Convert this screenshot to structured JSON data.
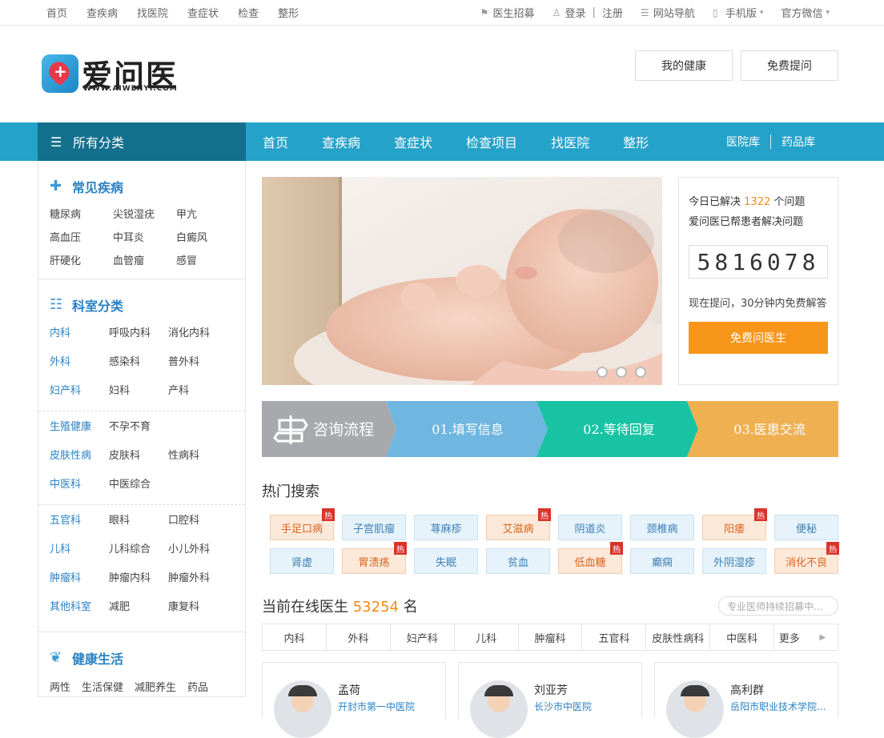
{
  "topbar": {
    "links": [
      "首页",
      "查疾病",
      "找医院",
      "查症状",
      "检查",
      "整形"
    ],
    "recruit": "医生招募",
    "login": "登录",
    "divider": "|",
    "register": "注册",
    "site_nav": "网站导航",
    "mobile": "手机版",
    "wechat": "官方微信"
  },
  "logo": {
    "brand": "爱问医",
    "url": "WWW.AIWENYI.COM"
  },
  "header": {
    "my_health": "我的健康",
    "free_ask": "免费提问"
  },
  "nav": {
    "all_categories": "所有分类",
    "items": [
      "首页",
      "查疾病",
      "查症状",
      "检查项目",
      "找医院",
      "整形"
    ],
    "hospital_lib": "医院库",
    "drug_lib": "药品库"
  },
  "sidebar": {
    "common_title": "常见疾病",
    "common": [
      "糖尿病",
      "尖锐湿疣",
      "甲亢",
      "高血压",
      "中耳炎",
      "白癜风",
      "肝硬化",
      "血管瘤",
      "感冒"
    ],
    "dept_title": "科室分类",
    "dept_groups": [
      [
        [
          "内科",
          "呼吸内科",
          "消化内科"
        ],
        [
          "外科",
          "感染科",
          "普外科"
        ],
        [
          "妇产科",
          "妇科",
          "产科"
        ]
      ],
      [
        [
          "生殖健康",
          "不孕不育",
          ""
        ],
        [
          "皮肤性病",
          "皮肤科",
          "性病科"
        ],
        [
          "中医科",
          "中医综合",
          ""
        ]
      ],
      [
        [
          "五官科",
          "眼科",
          "口腔科"
        ],
        [
          "儿科",
          "儿科综合",
          "小儿外科"
        ],
        [
          "肿瘤科",
          "肿瘤内科",
          "肿瘤外科"
        ],
        [
          "其他科室",
          "减肥",
          "康复科"
        ]
      ]
    ],
    "life_title": "健康生活",
    "life": [
      "两性",
      "生活保健",
      "减肥养生",
      "药品"
    ]
  },
  "stat": {
    "line1_pre": "今日已解决",
    "solved": "1322",
    "line1_post": "个问题",
    "line2": "爱问医已帮患者解决问题",
    "total": "5816078",
    "tip": "现在提问，30分钟内免费解答",
    "ask_button": "免费问医生"
  },
  "flow": {
    "title": "咨询流程",
    "steps": [
      "01.填写信息",
      "02.等待回复",
      "03.医患交流"
    ],
    "colors": [
      "#a7a9ac",
      "#6fb6e0",
      "#17c3a2",
      "#efb052"
    ]
  },
  "hot": {
    "title": "热门搜索",
    "hot_mark": "热",
    "row1": [
      {
        "t": "手足口病",
        "o": true,
        "h": true
      },
      {
        "t": "子宫肌瘤",
        "o": false,
        "h": false
      },
      {
        "t": "荨麻疹",
        "o": false,
        "h": false
      },
      {
        "t": "艾滋病",
        "o": true,
        "h": true
      },
      {
        "t": "阴道炎",
        "o": false,
        "h": false
      },
      {
        "t": "颈椎病",
        "o": false,
        "h": false
      },
      {
        "t": "阳痿",
        "o": true,
        "h": true
      },
      {
        "t": "便秘",
        "o": false,
        "h": false
      }
    ],
    "row2": [
      {
        "t": "肾虚",
        "o": false,
        "h": false
      },
      {
        "t": "胃溃疡",
        "o": true,
        "h": true
      },
      {
        "t": "失眠",
        "o": false,
        "h": false
      },
      {
        "t": "贫血",
        "o": false,
        "h": false
      },
      {
        "t": "低血糖",
        "o": true,
        "h": true
      },
      {
        "t": "癫痫",
        "o": false,
        "h": false
      },
      {
        "t": "外阴湿疹",
        "o": false,
        "h": false
      },
      {
        "t": "消化不良",
        "o": true,
        "h": true
      }
    ]
  },
  "online": {
    "pre": "当前在线医生",
    "count": "53254",
    "post": "名",
    "recruit_placeholder": "专业医师持续招募中...",
    "tabs": [
      "内科",
      "外科",
      "妇产科",
      "儿科",
      "肿瘤科",
      "五官科",
      "皮肤性病科",
      "中医科",
      "更多"
    ]
  },
  "doctors": [
    {
      "name": "孟荷",
      "hospital": "开封市第一中医院"
    },
    {
      "name": "刘亚芳",
      "hospital": "长沙市中医院"
    },
    {
      "name": "高利群",
      "hospital": "岳阳市职业技术学院..."
    }
  ]
}
